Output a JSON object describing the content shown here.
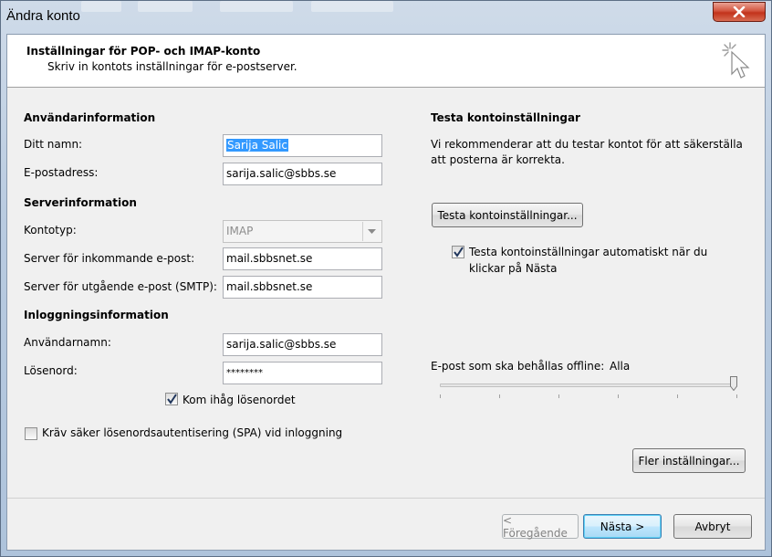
{
  "window": {
    "title": "Ändra konto"
  },
  "header": {
    "title": "Inställningar för POP- och IMAP-konto",
    "subtitle": "Skriv in kontots inställningar för e-postserver."
  },
  "user_info": {
    "section_title": "Användarinformation",
    "name_label": "Ditt namn:",
    "name_value": "Sarija Salic",
    "email_label": "E-postadress:",
    "email_value": "sarija.salic@sbbs.se"
  },
  "server_info": {
    "section_title": "Serverinformation",
    "account_type_label": "Kontotyp:",
    "account_type_value": "IMAP",
    "incoming_label": "Server för inkommande e-post:",
    "incoming_value": "mail.sbbsnet.se",
    "outgoing_label": "Server för utgående e-post (SMTP):",
    "outgoing_value": "mail.sbbsnet.se"
  },
  "login_info": {
    "section_title": "Inloggningsinformation",
    "username_label": "Användarnamn:",
    "username_value": "sarija.salic@sbbs.se",
    "password_label": "Lösenord:",
    "password_value": "********",
    "remember_label": "Kom ihåg lösenordet",
    "remember_checked": true,
    "spa_label": "Kräv säker lösenordsautentisering (SPA) vid inloggning",
    "spa_checked": false
  },
  "test": {
    "section_title": "Testa kontoinställningar",
    "description_line1": "Vi rekommenderar att du testar kontot för att säkerställa",
    "description_line2": "att posterna är korrekta.",
    "test_button": "Testa kontoinställningar...",
    "auto_test_line1": "Testa kontoinställningar automatiskt när du",
    "auto_test_line2": "klickar på Nästa",
    "auto_test_checked": true
  },
  "offline": {
    "label": "E-post som ska behållas offline:",
    "value": "Alla",
    "slider_level": 1.0
  },
  "buttons": {
    "more_settings": "Fler inställningar...",
    "back": "< Föregående",
    "next": "Nästa >",
    "cancel": "Avbryt"
  }
}
